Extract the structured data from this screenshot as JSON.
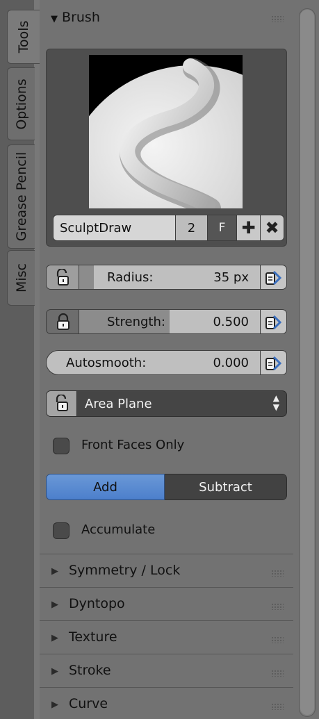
{
  "tabs": [
    {
      "label": "Tools",
      "active": true
    },
    {
      "label": "Options",
      "active": false
    },
    {
      "label": "Grease Pencil",
      "active": false
    },
    {
      "label": "Misc",
      "active": false
    }
  ],
  "brush_panel": {
    "title": "Brush",
    "expanded": true,
    "brush_name": "SculptDraw",
    "user_count": "2",
    "fake_user_label": "F",
    "add_icon": "plus-icon",
    "remove_icon": "x-icon"
  },
  "sliders": {
    "radius": {
      "label": "Radius:",
      "value": "35 px",
      "fill_fraction": 0.08,
      "locked": false
    },
    "strength": {
      "label": "Strength:",
      "value": "0.500",
      "fill_fraction": 0.5,
      "locked": true
    },
    "autosmooth": {
      "label": "Autosmooth:",
      "value": "0.000",
      "fill_fraction": 0.0
    }
  },
  "sculpt_plane": {
    "value": "Area Plane"
  },
  "front_faces_only": {
    "label": "Front Faces Only",
    "checked": false
  },
  "direction": {
    "add_label": "Add",
    "subtract_label": "Subtract",
    "selected": "Add"
  },
  "accumulate": {
    "label": "Accumulate",
    "checked": false
  },
  "sections": [
    {
      "label": "Symmetry / Lock"
    },
    {
      "label": "Dyntopo"
    },
    {
      "label": "Texture"
    },
    {
      "label": "Stroke"
    },
    {
      "label": "Curve"
    }
  ],
  "colors": {
    "panel_bg": "#727272",
    "accent_blue": "#5b8bd1",
    "dark_widget": "#424242"
  }
}
